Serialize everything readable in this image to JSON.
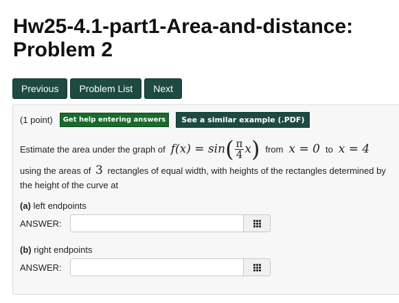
{
  "title": "Hw25-4.1-part1-Area-and-distance: Problem 2",
  "nav": {
    "previous": "Previous",
    "problem_list": "Problem List",
    "next": "Next"
  },
  "problem": {
    "points": "(1 point)",
    "help_label": "Get help entering answers",
    "example_label": "See a similar example (.PDF)",
    "text_estimate": "Estimate the area under the graph of",
    "func_lhs": "f(x) = sin",
    "frac_num": "π",
    "frac_den": "4",
    "func_var": "x",
    "text_from": "from",
    "from_expr": "x = 0",
    "text_to": "to",
    "to_expr": "x = 4",
    "text_using": "using the areas of",
    "num_rect": "3",
    "text_rest": "rectangles of equal width, with heights of the rectangles determined by the height of the curve at",
    "parts": [
      {
        "letter": "(a)",
        "label": "left endpoints",
        "answer_label": "ANSWER:",
        "value": ""
      },
      {
        "letter": "(b)",
        "label": "right endpoints",
        "answer_label": "ANSWER:",
        "value": ""
      }
    ]
  }
}
